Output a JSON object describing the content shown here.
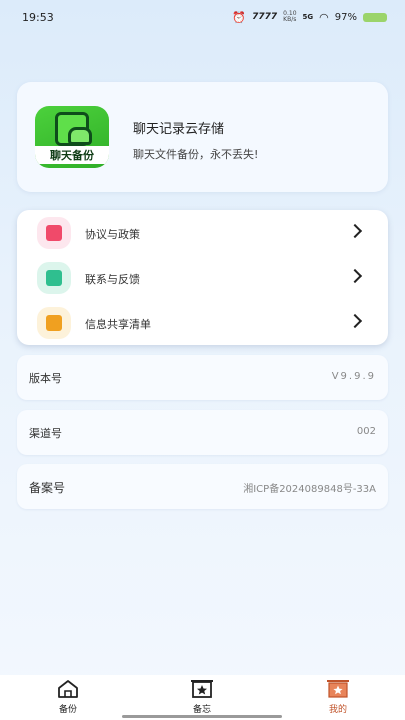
{
  "status_bar": {
    "time": "19:53",
    "signal_text": "7777",
    "speed_top": "0.10",
    "speed_bottom": "KB/s",
    "network": "5G",
    "battery": "97%"
  },
  "profile": {
    "logo_text": "聊天备份",
    "title": "聊天记录云存储",
    "subtitle": "聊天文件备份，永不丢失!"
  },
  "menu": {
    "items": [
      {
        "label": "协议与政策",
        "icon": "document-icon",
        "color": "#f04a6a"
      },
      {
        "label": "联系与反馈",
        "icon": "mail-icon",
        "color": "#2fbf8f"
      },
      {
        "label": "信息共享清单",
        "icon": "search-document-icon",
        "color": "#f0a020"
      }
    ]
  },
  "info": {
    "version_label": "版本号",
    "version_value": "V9.9.9",
    "channel_label": "渠道号",
    "channel_value": "002",
    "record_label": "备案号",
    "record_value": "湘ICP备2024089848号-33A"
  },
  "tabs": [
    {
      "label": "备份",
      "icon": "home-icon"
    },
    {
      "label": "备忘",
      "icon": "star-note-icon"
    },
    {
      "label": "我的",
      "icon": "profile-star-icon",
      "active_color": "#c0532a"
    }
  ]
}
